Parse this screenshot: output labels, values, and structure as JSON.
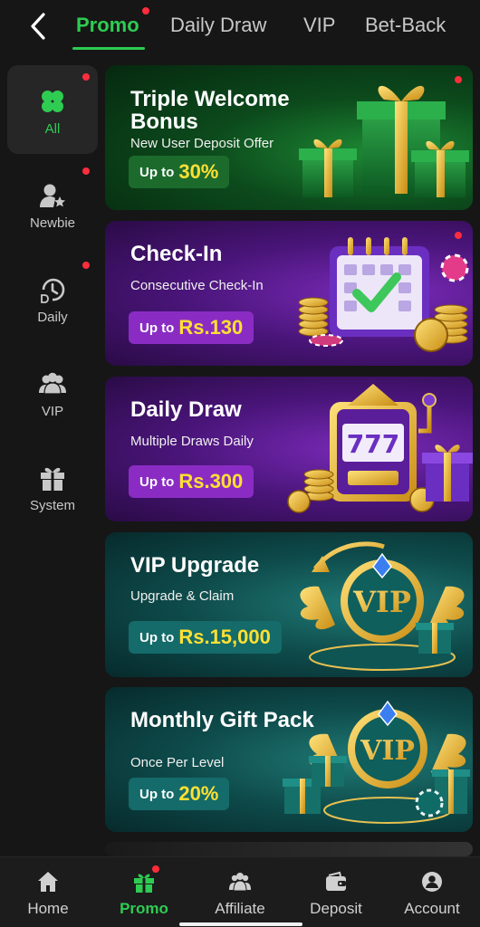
{
  "header": {
    "tabs": [
      {
        "label": "Promo",
        "active": true
      },
      {
        "label": "Daily Draw"
      },
      {
        "label": "VIP"
      },
      {
        "label": "Bet-Back"
      }
    ],
    "back_icon": "chevron-left-icon"
  },
  "sidebar": {
    "items": [
      {
        "label": "All",
        "icon": "clover-icon",
        "active": true,
        "badge": true
      },
      {
        "label": "Newbie",
        "icon": "user-star-icon",
        "badge": true
      },
      {
        "label": "Daily",
        "icon": "clock-d-icon",
        "badge": true
      },
      {
        "label": "VIP",
        "icon": "users-icon",
        "badge": false
      },
      {
        "label": "System",
        "icon": "gift-icon",
        "badge": false
      }
    ]
  },
  "promos": [
    {
      "title": "Triple Welcome Bonus",
      "subtitle": "New User Deposit Offer",
      "prefix": "Up to",
      "value": "30%",
      "badge": true
    },
    {
      "title": "Check-In",
      "subtitle": "Consecutive Check-In",
      "prefix": "Up to",
      "value": "Rs.130",
      "badge": true
    },
    {
      "title": "Daily Draw",
      "subtitle": "Multiple Draws Daily",
      "prefix": "Up to",
      "value": "Rs.300"
    },
    {
      "title": "VIP Upgrade",
      "subtitle": "Upgrade & Claim",
      "prefix": "Up to",
      "value": "Rs.15,000"
    },
    {
      "title": "Monthly Gift Pack",
      "subtitle": "Once Per Level",
      "prefix": "Up to",
      "value": "20%"
    }
  ],
  "art_text": {
    "vip": "VIP",
    "slot": "777"
  },
  "nav": {
    "items": [
      {
        "label": "Home",
        "icon": "home-icon"
      },
      {
        "label": "Promo",
        "icon": "gift-icon",
        "active": true,
        "badge": true
      },
      {
        "label": "Affiliate",
        "icon": "users-icon"
      },
      {
        "label": "Deposit",
        "icon": "wallet-icon"
      },
      {
        "label": "Account",
        "icon": "account-icon"
      }
    ]
  },
  "colors": {
    "accent": "#2ecc52",
    "badge": "#ff2d3c",
    "highlight": "#ffe033"
  }
}
